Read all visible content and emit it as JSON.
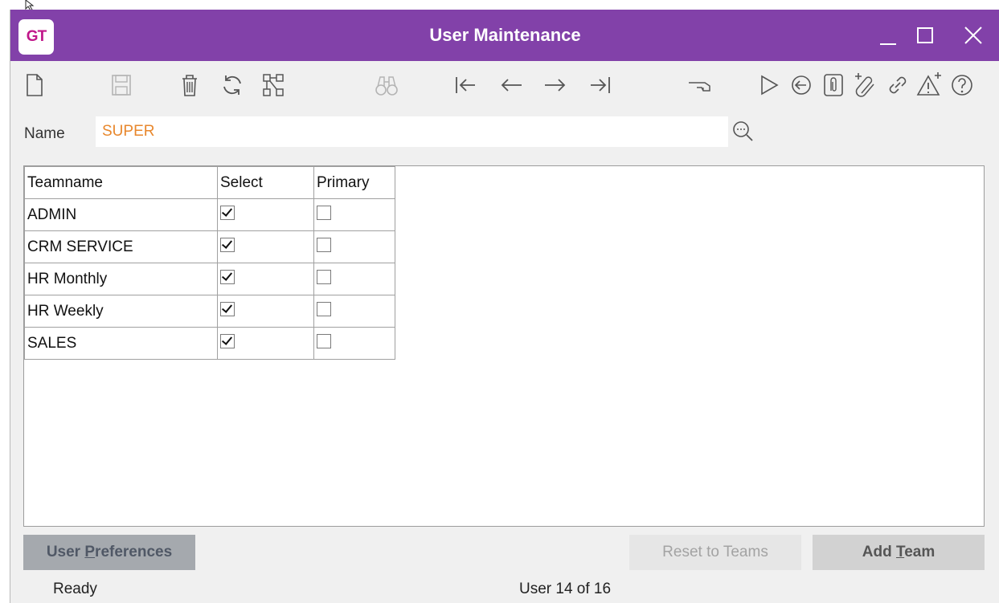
{
  "window": {
    "logo_text": "GT",
    "title": "User Maintenance",
    "accent_color": "#8241a9",
    "controls": [
      "minimize-icon",
      "maximize-icon",
      "close-icon"
    ]
  },
  "toolbar": {
    "icons": [
      "new-document-icon",
      "save-icon",
      "delete-icon",
      "refresh-icon",
      "hierarchy-icon",
      "find-icon",
      "first-record-icon",
      "previous-record-icon",
      "next-record-icon",
      "last-record-icon",
      "hand-pointer-icon",
      "run-icon",
      "back-circle-icon",
      "attachment-icon",
      "add-attachment-icon",
      "link-icon",
      "add-alert-icon",
      "help-icon"
    ]
  },
  "name_field": {
    "label": "Name",
    "value": "SUPER"
  },
  "grid": {
    "columns": [
      "Teamname",
      "Select",
      "Primary"
    ],
    "rows": [
      {
        "teamname": "ADMIN",
        "select": true,
        "primary": false
      },
      {
        "teamname": "CRM SERVICE",
        "select": true,
        "primary": false
      },
      {
        "teamname": "HR Monthly",
        "select": true,
        "primary": false
      },
      {
        "teamname": "HR Weekly",
        "select": true,
        "primary": false
      },
      {
        "teamname": "SALES",
        "select": true,
        "primary": false
      }
    ]
  },
  "buttons": {
    "user_preferences_pre": "User ",
    "user_preferences_key": "P",
    "user_preferences_post": "references",
    "reset_to_teams": "Reset to Teams",
    "add_team_pre": "Add ",
    "add_team_key": "T",
    "add_team_post": "eam"
  },
  "status": {
    "left": "Ready",
    "record": "User 14 of 16"
  }
}
